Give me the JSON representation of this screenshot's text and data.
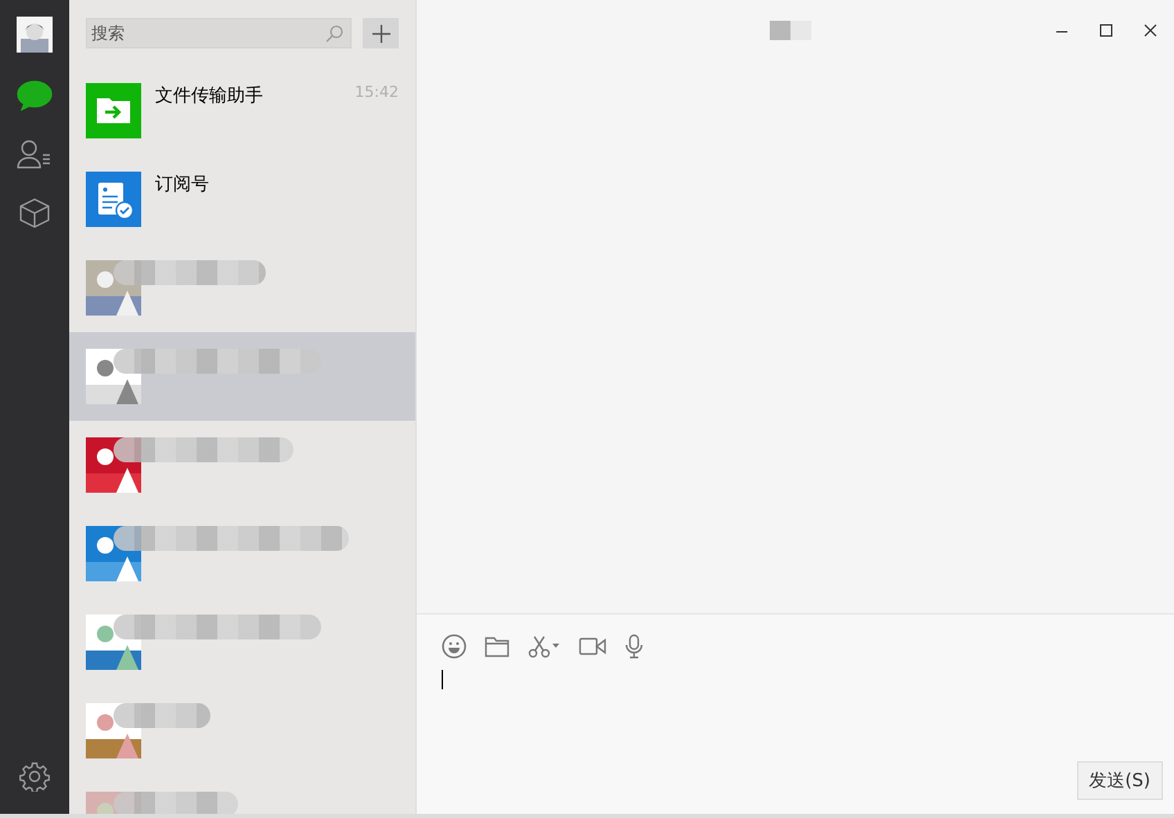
{
  "search": {
    "placeholder": "搜索"
  },
  "nav": [
    {
      "kind": "chat",
      "selected": true
    },
    {
      "kind": "contacts",
      "selected": false
    },
    {
      "kind": "favorites",
      "selected": false
    }
  ],
  "conversations": [
    {
      "kind": "file-transfer",
      "name": "文件传输助手",
      "time": "15:42",
      "selected": false
    },
    {
      "kind": "subscription",
      "name": "订阅号",
      "selected": false
    },
    {
      "kind": "picture",
      "selected": false
    },
    {
      "kind": "picture",
      "selected": true
    },
    {
      "kind": "picture",
      "selected": false
    },
    {
      "kind": "picture",
      "selected": false
    },
    {
      "kind": "picture",
      "selected": false
    },
    {
      "kind": "picture",
      "selected": false
    },
    {
      "kind": "picture",
      "selected": false
    }
  ],
  "composer": {
    "send_button": "发送(S)"
  }
}
